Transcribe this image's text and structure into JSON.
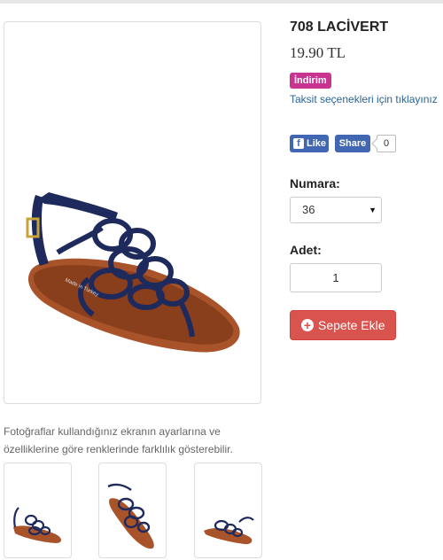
{
  "product": {
    "title": "708 LACİVERT",
    "price": "19.90 TL",
    "badge": "İndirim",
    "installment_link": "Taksit seçenekleri için tıklayınız"
  },
  "social": {
    "like_label": "Like",
    "share_label": "Share",
    "share_count": "0"
  },
  "size": {
    "label": "Numara:",
    "selected": "36"
  },
  "quantity": {
    "label": "Adet:",
    "value": "1"
  },
  "cart": {
    "button_label": "Sepete Ekle"
  },
  "gallery": {
    "disclaimer_line1": "Fotoğraflar kullandığınız ekranın ayarlarına ve",
    "disclaimer_line2": "özelliklerine göre renklerinde farklılık gösterebilir.",
    "thumbnail_count": 3
  },
  "colors": {
    "badge": "#c8348f",
    "link": "#2a6496",
    "facebook": "#4267b2",
    "cart_button": "#d9534f",
    "sandal_strap": "#1f2a5c",
    "sandal_sole": "#a9532a"
  }
}
